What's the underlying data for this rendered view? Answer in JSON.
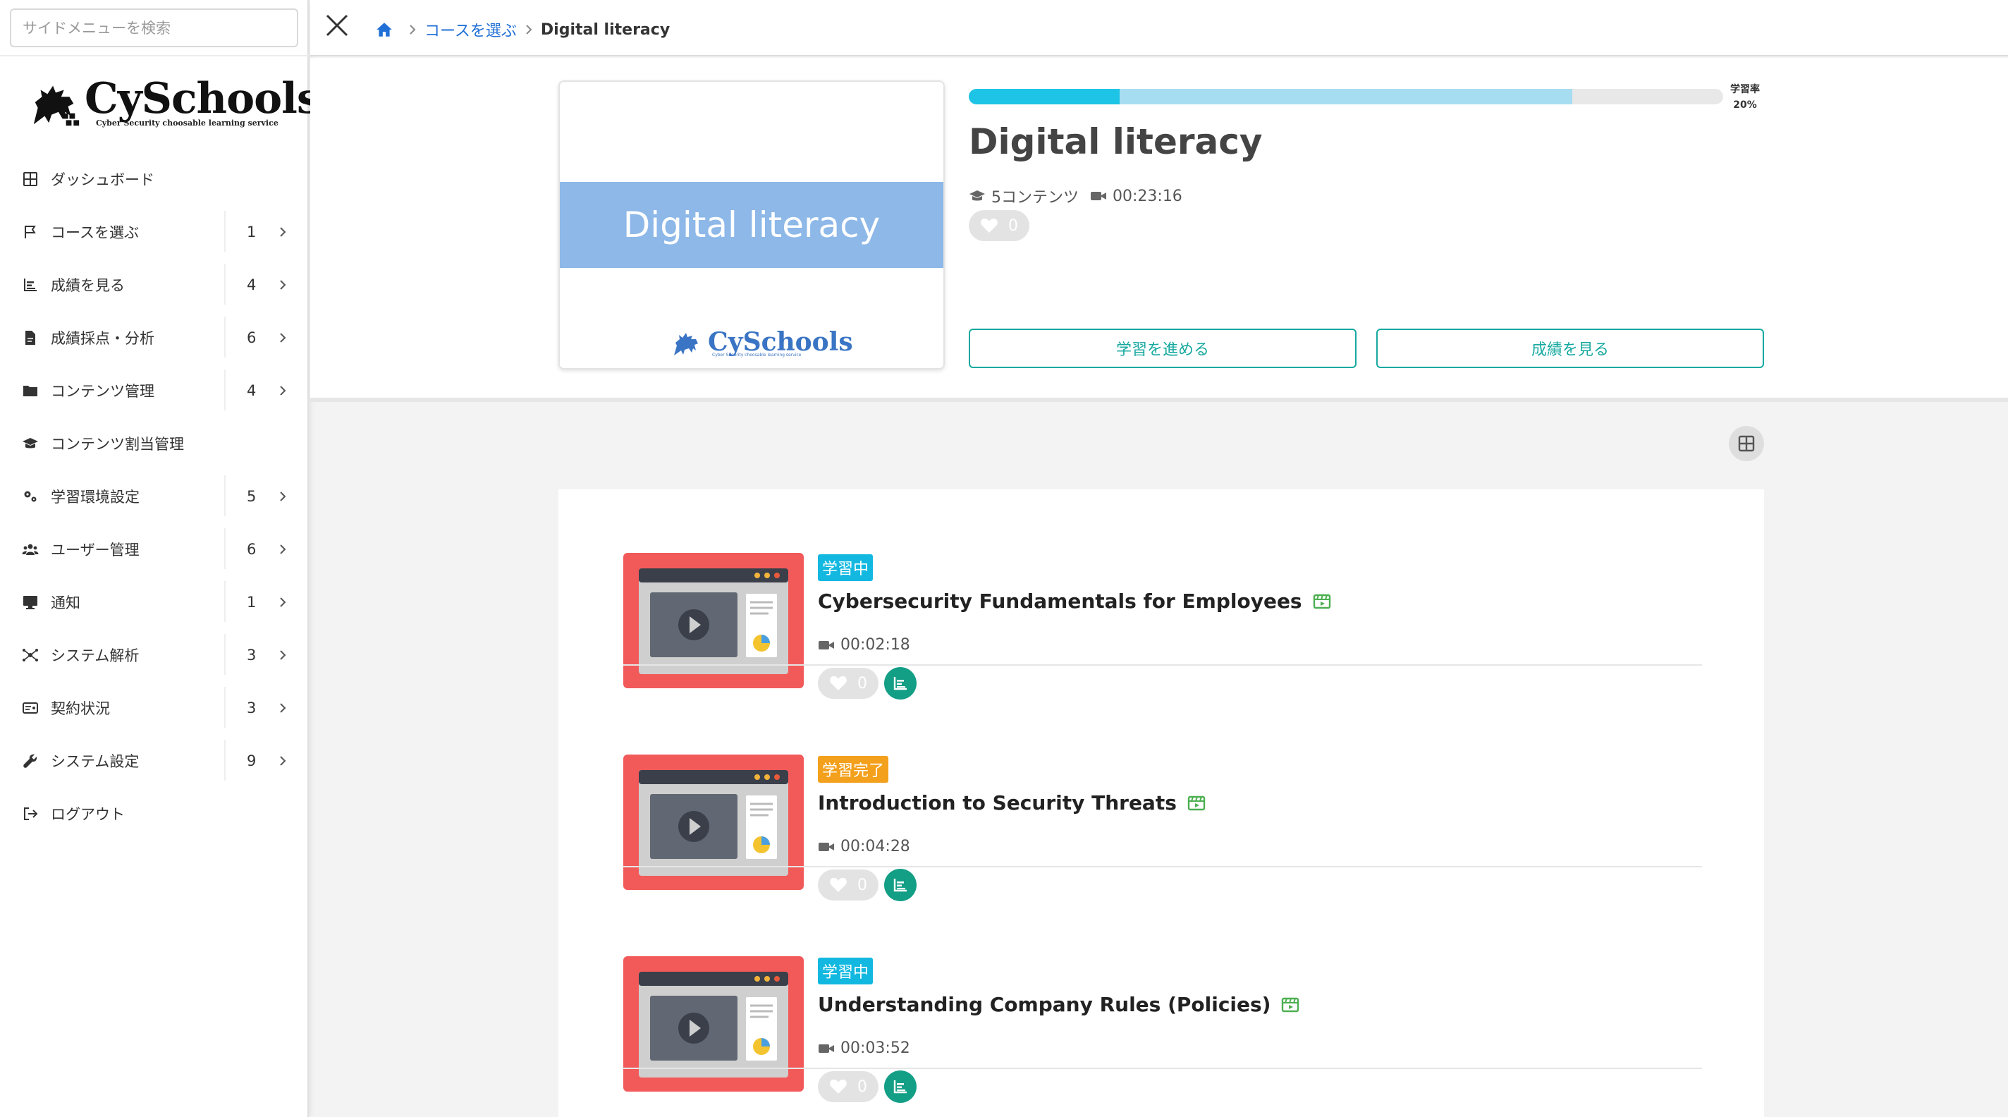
{
  "sidebar": {
    "search_placeholder": "サイドメニューを検索",
    "logo": {
      "name": "CySchools",
      "tagline": "Cyber Security choosable learning service"
    },
    "items": [
      {
        "label": "ダッシュボード",
        "icon": "grid-icon",
        "count": ""
      },
      {
        "label": "コースを選ぶ",
        "icon": "flag-icon",
        "count": "1"
      },
      {
        "label": "成績を見る",
        "icon": "bar-chart-icon",
        "count": "4"
      },
      {
        "label": "成績採点・分析",
        "icon": "file-icon",
        "count": "6"
      },
      {
        "label": "コンテンツ管理",
        "icon": "folder-icon",
        "count": "4"
      },
      {
        "label": "コンテンツ割当管理",
        "icon": "graduation-cap-icon",
        "count": ""
      },
      {
        "label": "学習環境設定",
        "icon": "cogs-icon",
        "count": "5"
      },
      {
        "label": "ユーザー管理",
        "icon": "users-icon",
        "count": "6"
      },
      {
        "label": "通知",
        "icon": "monitor-icon",
        "count": "1"
      },
      {
        "label": "システム解析",
        "icon": "network-icon",
        "count": "3"
      },
      {
        "label": "契約状況",
        "icon": "id-card-icon",
        "count": "3"
      },
      {
        "label": "システム設定",
        "icon": "wrench-icon",
        "count": "9"
      },
      {
        "label": "ログアウト",
        "icon": "logout-icon",
        "count": ""
      }
    ]
  },
  "breadcrumb": {
    "link": "コースを選ぶ",
    "current": "Digital literacy"
  },
  "course": {
    "thumbnail_text": "Digital literacy",
    "title": "Digital literacy",
    "contents": "5コンテンツ",
    "duration": "00:23:16",
    "likes": "0",
    "progress_label": "学習率",
    "progress_percent": "20%",
    "progress_value": 0.2,
    "progress_secondary_value": 0.8,
    "continue_label": "学習を進める",
    "results_label": "成績を見る"
  },
  "colors": {
    "accent": "#17a9a0",
    "progress": "#1ec4e6",
    "in_progress_tag": "#12b8e0",
    "done_tag": "#f3a01c",
    "lesson_thumb": "#f25a5a"
  },
  "lessons": [
    {
      "status": "学習中",
      "status_type": "progress",
      "title": "Cybersecurity Fundamentals for Employees",
      "duration": "00:02:18",
      "likes": "0"
    },
    {
      "status": "学習完了",
      "status_type": "done",
      "title": "Introduction to Security Threats",
      "duration": "00:04:28",
      "likes": "0"
    },
    {
      "status": "学習中",
      "status_type": "progress",
      "title": "Understanding Company Rules (Policies)",
      "duration": "00:03:52",
      "likes": "0"
    }
  ]
}
